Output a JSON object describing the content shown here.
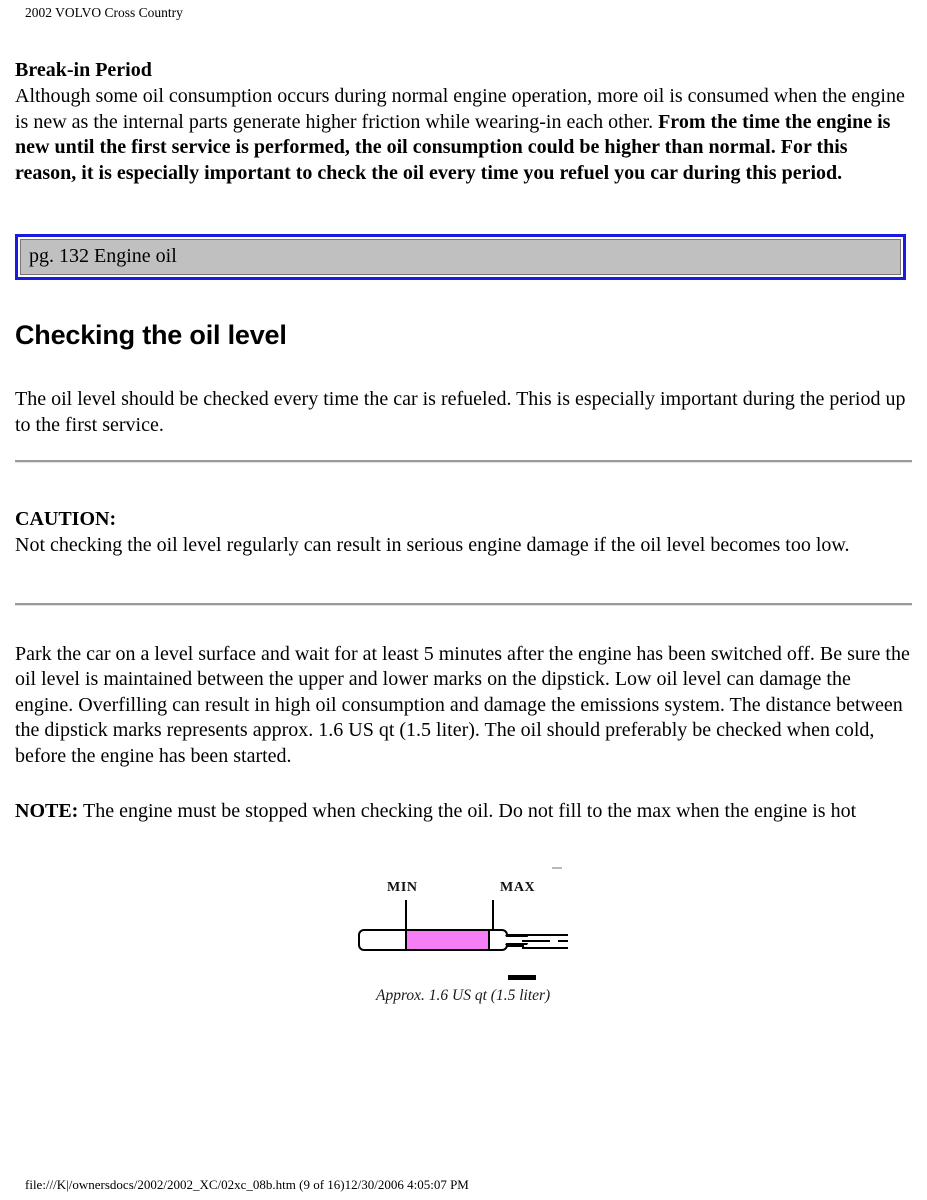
{
  "header": {
    "title": "2002 VOLVO Cross Country"
  },
  "break_in": {
    "heading": "Break-in Period",
    "paragraph_normal": "Although some oil consumption occurs during normal engine operation, more oil is consumed when the engine is new as the internal parts generate higher friction while wearing-in each other. ",
    "paragraph_bold": "From the time the engine is new until the first service is performed, the oil consumption could be higher than normal. For this reason, it is especially important to check the oil every time you refuel you car during this period."
  },
  "link_box": {
    "label": "pg. 132 Engine oil",
    "border_color": "#1a1ae0",
    "fill_color": "#c0c0c0"
  },
  "section": {
    "title": "Checking the oil level",
    "intro": "The oil level should be checked every time the car is refueled. This is especially important during the period up to the first service."
  },
  "caution": {
    "label": "CAUTION:",
    "text": "Not checking the oil level regularly can result in serious engine damage if the oil level becomes too low."
  },
  "procedure": {
    "paragraph": "Park the car on a level surface and wait for at least 5 minutes after the engine has been switched off. Be sure the oil level is maintained between the upper and lower marks on the dipstick. Low oil level can damage the engine. Overfilling can result in high oil consumption and damage the emissions system. The distance between the dipstick marks represents approx. 1.6 US qt (1.5 liter). The oil should preferably be checked when cold, before the engine has been started.",
    "note_label": "NOTE:",
    "note_text": " The engine must be stopped when checking the oil. Do not fill to the max when the engine is hot"
  },
  "figure": {
    "min_label": "MIN",
    "max_label": "MAX",
    "caption": "Approx. 1.6 US qt (1.5 liter)",
    "fill_color": "#f57ef5"
  },
  "footer": {
    "path_info": "file:///K|/ownersdocs/2002/2002_XC/02xc_08b.htm (9 of 16)12/30/2006 4:05:07 PM"
  }
}
